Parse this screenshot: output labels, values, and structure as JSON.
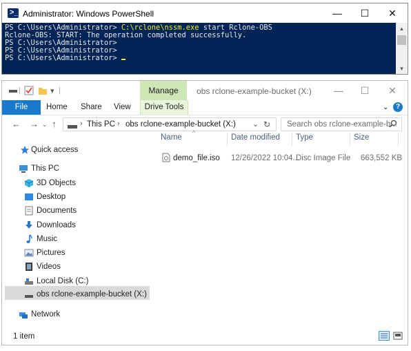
{
  "powershell": {
    "title": "Administrator: Windows PowerShell",
    "lines": [
      {
        "prompt": "PS C:\\Users\\Administrator> ",
        "command": "C:\\rclone\\nssm.exe",
        "args": " start Rclone-OBS"
      },
      {
        "text": "Rclone-OBS: START: The operation completed successfully."
      },
      {
        "text": "PS C:\\Users\\Administrator>"
      },
      {
        "text": "PS C:\\Users\\Administrator> "
      },
      {
        "text": "PS C:\\Users\\Administrator> "
      }
    ],
    "controls": {
      "minimize": "—",
      "maximize": "☐",
      "close": "✕"
    }
  },
  "explorer": {
    "title": "obs rclone-example-bucket (X:)",
    "manage_tab": "Manage",
    "ribbon_tabs": [
      "File",
      "Home",
      "Share",
      "View"
    ],
    "drive_tools": "Drive Tools",
    "breadcrumb": [
      "This PC",
      "obs rclone-example-bucket (X:)"
    ],
    "search_placeholder": "Search obs rclone-example-b...",
    "nav": {
      "quick_access": "Quick access",
      "this_pc": "This PC",
      "items": [
        "3D Objects",
        "Desktop",
        "Documents",
        "Downloads",
        "Music",
        "Pictures",
        "Videos",
        "Local Disk (C:)",
        "obs rclone-example-bucket (X:)"
      ],
      "network": "Network"
    },
    "columns": [
      "Name",
      "Date modified",
      "Type",
      "Size"
    ],
    "files": [
      {
        "name": "demo_file.iso",
        "date": "12/26/2022 10:04...",
        "type": "Disc Image File",
        "size": "663,552 KB"
      }
    ],
    "status": "1 item"
  },
  "colors": {
    "ps_bg": "#012456",
    "ps_highlight": "#f2f21a",
    "file_tab": "#1979ca",
    "manage_tab": "#cfe7b7",
    "selection": "#d9d9d9"
  }
}
